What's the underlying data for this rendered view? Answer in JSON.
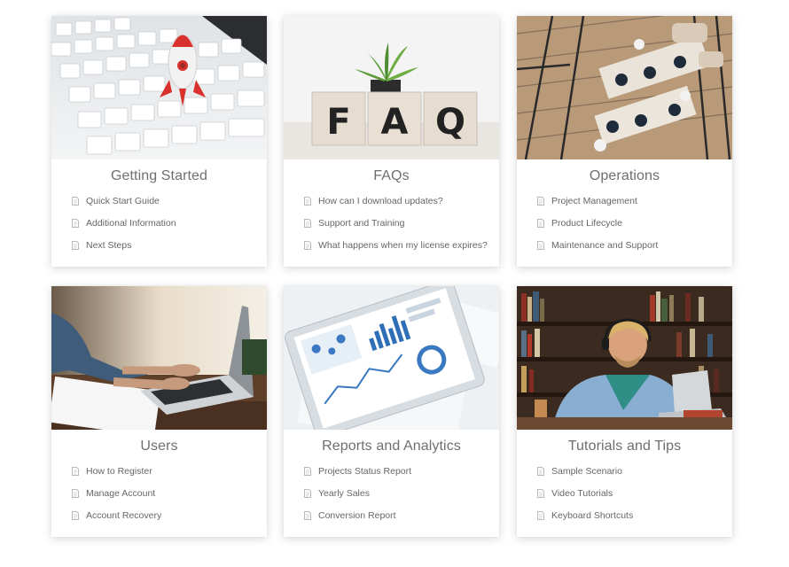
{
  "cards": [
    {
      "title": "Getting Started",
      "image": "rocket-on-keyboard-image",
      "items": [
        "Quick Start Guide",
        "Additional Information",
        "Next Steps"
      ]
    },
    {
      "title": "FAQs",
      "image": "faq-blocks-image",
      "image_text": "FAQ",
      "items": [
        "How can I download updates?",
        "Support and Training",
        "What happens when my license expires?"
      ]
    },
    {
      "title": "Operations",
      "image": "office-overhead-image",
      "items": [
        "Project Management",
        "Product Lifecycle",
        "Maintenance and Support"
      ]
    },
    {
      "title": "Users",
      "image": "laptop-typing-image",
      "items": [
        "How to Register",
        "Manage Account",
        "Account Recovery"
      ]
    },
    {
      "title": "Reports and Analytics",
      "image": "tablet-dashboard-image",
      "items": [
        "Projects Status Report",
        "Yearly Sales",
        "Conversion Report"
      ]
    },
    {
      "title": "Tutorials and Tips",
      "image": "student-library-image",
      "items": [
        "Sample Scenario",
        "Video Tutorials",
        "Keyboard Shortcuts"
      ]
    }
  ],
  "colors": {
    "title_text": "#6f6f6f",
    "link_text": "#666666",
    "doc_icon": "#b9b9b9",
    "card_background": "#ffffff"
  }
}
